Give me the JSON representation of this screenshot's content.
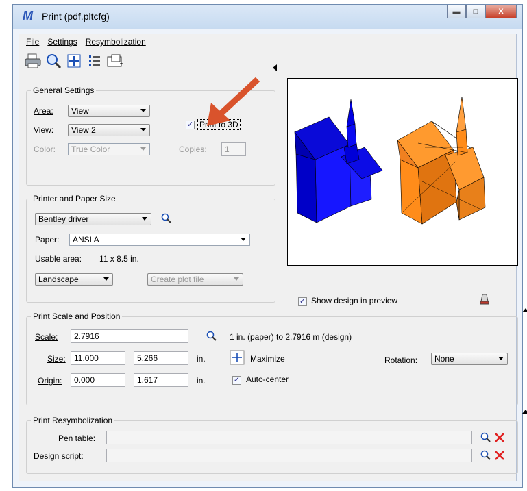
{
  "window": {
    "title": "Print  (pdf.pltcfg)"
  },
  "menu": {
    "file": "File",
    "settings": "Settings",
    "resymbolization": "Resymbolization"
  },
  "toolbar": {
    "icons": [
      "printer-icon",
      "preview-magnifier-icon",
      "fit-area-icon",
      "list-icon",
      "page-setup-icon"
    ]
  },
  "general": {
    "title": "General Settings",
    "area_label": "Area:",
    "area_value": "View",
    "view_label": "View:",
    "view_value": "View 2",
    "color_label": "Color:",
    "color_value": "True Color",
    "print3d_label": "Print to 3D",
    "print3d_checked": true,
    "copies_label": "Copies:",
    "copies_value": "1"
  },
  "printer": {
    "title": "Printer and Paper Size",
    "driver": "Bentley driver",
    "paper_label": "Paper:",
    "paper_value": "ANSI A",
    "usable_label": "Usable area:",
    "usable_value": "11 x 8.5 in.",
    "orientation": "Landscape",
    "create_plot": "Create plot file"
  },
  "preview": {
    "show_label": "Show design in preview",
    "show_checked": true
  },
  "scale": {
    "title": "Print Scale and Position",
    "scale_label": "Scale:",
    "scale_value": "2.7916",
    "scale_text": "1 in. (paper) to 2.7916 m (design)",
    "size_label": "Size:",
    "size_w": "11.000",
    "size_h": "5.266",
    "size_unit": "in.",
    "maximize": "Maximize",
    "rotation_label": "Rotation:",
    "rotation_value": "None",
    "origin_label": "Origin:",
    "origin_x": "0.000",
    "origin_y": "1.617",
    "origin_unit": "in.",
    "autocenter": "Auto-center",
    "autocenter_checked": true
  },
  "resym": {
    "title": "Print Resymbolization",
    "pen_label": "Pen table:",
    "pen_value": "",
    "script_label": "Design script:",
    "script_value": ""
  },
  "colors": {
    "blue_model": "#1414ff",
    "orange_model": "#ff8c1a",
    "arrow": "#d9532c"
  }
}
